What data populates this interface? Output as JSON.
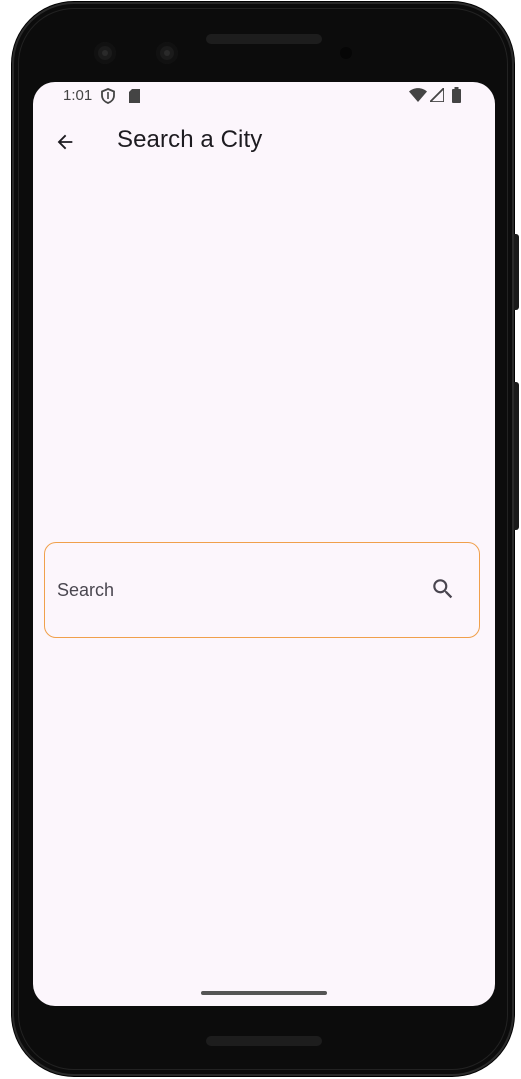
{
  "status_bar": {
    "time": "1:01",
    "icons": [
      "shield-icon",
      "sd-card-icon",
      "wifi-icon",
      "signal-icon",
      "battery-icon"
    ]
  },
  "app_bar": {
    "back_icon": "arrow-back-icon",
    "title": "Search a City"
  },
  "search": {
    "placeholder": "Search",
    "value": "",
    "icon": "search-icon",
    "border_color": "#f0a04b"
  },
  "colors": {
    "screen_background": "#fcf6fc",
    "title_text": "#1d1b20"
  }
}
